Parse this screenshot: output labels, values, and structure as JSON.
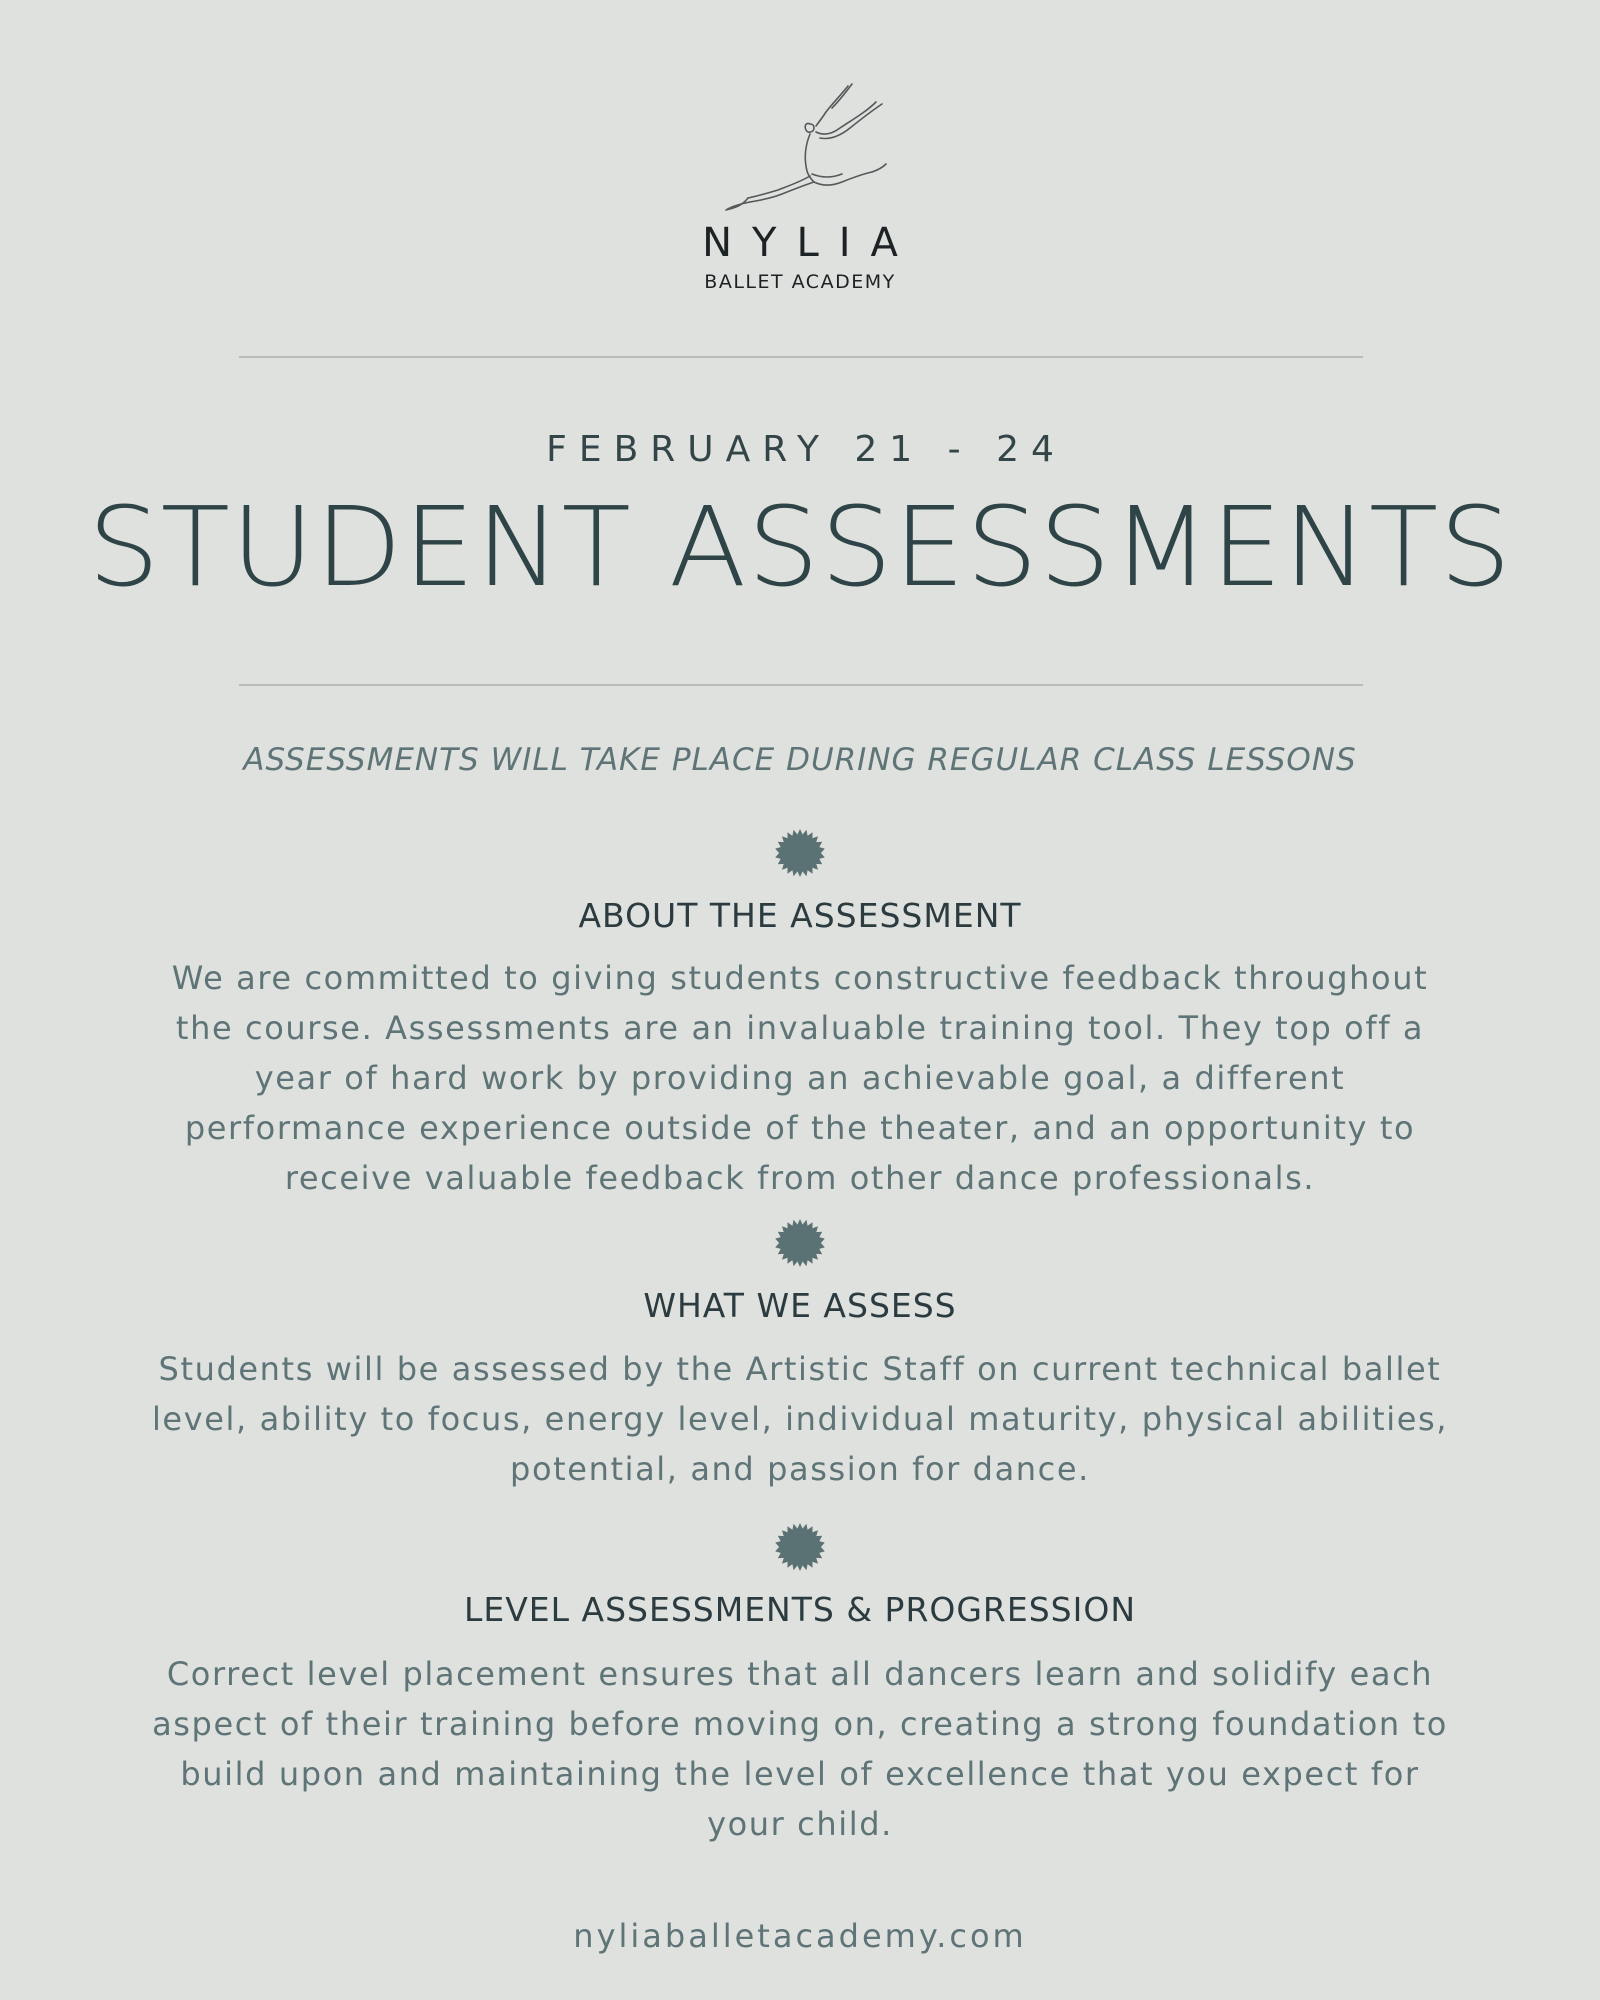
{
  "brand": {
    "name": "NYLIA",
    "subtitle": "BALLET ACADEMY"
  },
  "event": {
    "dates": "FEBRUARY 21 - 24",
    "title": "STUDENT ASSESSMENTS",
    "tagline": "ASSESSMENTS WILL TAKE PLACE DURING REGULAR CLASS LESSONS"
  },
  "sections": [
    {
      "heading": "ABOUT THE ASSESSMENT",
      "body": "We are committed to giving students constructive feedback throughout the course. Assessments are an invaluable training tool. They top off a year of hard work by providing an achievable goal, a different performance experience outside of the theater, and an opportunity to receive valuable feedback from other dance professionals."
    },
    {
      "heading": "WHAT WE ASSESS",
      "body": "Students will be assessed by the Artistic Staff on current technical ballet level, ability to focus, energy level, individual maturity, physical abilities, potential, and passion for dance."
    },
    {
      "heading": "LEVEL ASSESSMENTS & PROGRESSION",
      "body": "Correct level placement ensures that all dancers learn and solidify each aspect of their training before moving on, creating a strong foundation to build upon and maintaining the level of excellence that you expect for your child."
    }
  ],
  "footer": {
    "website": "nyliaballetacademy.com"
  },
  "icons": {
    "logo": "dancer-leap-icon",
    "divider": "starburst-badge-icon"
  },
  "colors": {
    "background": "#dfe1de",
    "heading": "#2f4447",
    "body": "#5f7477",
    "badge": "#5b7275",
    "rule": "#b9bcba"
  }
}
